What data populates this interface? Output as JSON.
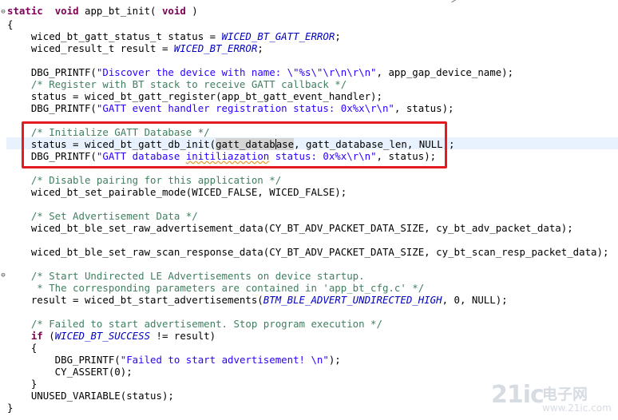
{
  "editor": {
    "fold_markers": {
      "func": "⊖",
      "comment": "⊖"
    },
    "lines": [
      {
        "id": "l01",
        "segs": [
          [
            "kw",
            "static"
          ],
          [
            "",
            ""
          ],
          [
            "",
            "  "
          ],
          [
            "kw",
            "void"
          ],
          [
            "",
            " app_bt_init( "
          ],
          [
            "kw",
            "void"
          ],
          [
            "",
            " )"
          ]
        ]
      },
      {
        "id": "l02",
        "segs": [
          [
            "",
            "{"
          ]
        ]
      },
      {
        "id": "l03",
        "segs": [
          [
            "",
            "    wiced_bt_gatt_status_t status = "
          ],
          [
            "mac",
            "WICED_BT_GATT_ERROR"
          ],
          [
            "",
            ";"
          ]
        ]
      },
      {
        "id": "l04",
        "segs": [
          [
            "",
            "    wiced_result_t result = "
          ],
          [
            "mac",
            "WICED_BT_ERROR"
          ],
          [
            "",
            ";"
          ]
        ]
      },
      {
        "id": "l05",
        "segs": [
          [
            "",
            ""
          ]
        ]
      },
      {
        "id": "l06",
        "segs": [
          [
            "",
            "    DBG_PRINTF("
          ],
          [
            "str",
            "\"Discover the device with name: \\\"%s\\\"\\r\\n\\r\\n\""
          ],
          [
            "",
            ", app_gap_device_name);"
          ]
        ]
      },
      {
        "id": "l07",
        "segs": [
          [
            "cmt",
            "    /* Register with BT stack to receive GATT callback */"
          ]
        ]
      },
      {
        "id": "l08",
        "segs": [
          [
            "",
            "    status = wiced_bt_gatt_register(app_bt_gatt_event_handler);"
          ]
        ]
      },
      {
        "id": "l09",
        "segs": [
          [
            "",
            "    DBG_PRINTF("
          ],
          [
            "str",
            "\"GATT event handler registration status: 0x%x\\r\\n\""
          ],
          [
            "",
            ", status);"
          ]
        ]
      },
      {
        "id": "l10",
        "segs": [
          [
            "",
            ""
          ]
        ]
      },
      {
        "id": "l11",
        "segs": [
          [
            "cmt",
            "    /* Initialize GATT Database */"
          ]
        ]
      },
      {
        "id": "l12",
        "segs": [
          [
            "",
            "    status = wiced_bt_gatt_db_init("
          ],
          [
            "word-hl",
            "gatt_datab"
          ],
          [
            "caret",
            ""
          ],
          [
            "word-hl",
            "ase"
          ],
          [
            "",
            ", gatt_database_len, NULL);"
          ]
        ]
      },
      {
        "id": "l13",
        "segs": [
          [
            "",
            "    DBG_PRINTF("
          ],
          [
            "str",
            "\"GATT database "
          ],
          [
            "str sq",
            "initiliazation"
          ],
          [
            "str",
            " status: 0x%x\\r\\n\""
          ],
          [
            "",
            ", status);"
          ]
        ]
      },
      {
        "id": "l14",
        "segs": [
          [
            "",
            ""
          ]
        ]
      },
      {
        "id": "l15",
        "segs": [
          [
            "cmt",
            "    /* Disable pairing for this application */"
          ]
        ]
      },
      {
        "id": "l16",
        "segs": [
          [
            "",
            "    wiced_bt_set_pairable_mode(WICED_FALSE, WICED_FALSE);"
          ]
        ]
      },
      {
        "id": "l17",
        "segs": [
          [
            "",
            ""
          ]
        ]
      },
      {
        "id": "l18",
        "segs": [
          [
            "cmt",
            "    /* Set Advertisement Data */"
          ]
        ]
      },
      {
        "id": "l19",
        "segs": [
          [
            "",
            "    wiced_bt_ble_set_raw_advertisement_data(CY_BT_ADV_PACKET_DATA_SIZE, cy_bt_adv_packet_data);"
          ]
        ]
      },
      {
        "id": "l20",
        "segs": [
          [
            "",
            ""
          ]
        ]
      },
      {
        "id": "l21",
        "segs": [
          [
            "",
            "    wiced_bt_ble_set_raw_scan_response_data(CY_BT_ADV_PACKET_DATA_SIZE, cy_bt_scan_resp_packet_data);"
          ]
        ]
      },
      {
        "id": "l22",
        "segs": [
          [
            "",
            ""
          ]
        ]
      },
      {
        "id": "l23",
        "segs": [
          [
            "cmt",
            "    /* Start Undirected LE Advertisements on device startup."
          ]
        ]
      },
      {
        "id": "l24",
        "segs": [
          [
            "cmt",
            "     * The corresponding parameters are contained in 'app_bt_cfg.c' */"
          ]
        ]
      },
      {
        "id": "l25",
        "segs": [
          [
            "",
            "    result = wiced_bt_start_advertisements("
          ],
          [
            "mac",
            "BTM_BLE_ADVERT_UNDIRECTED_HIGH"
          ],
          [
            "",
            ", 0, NULL);"
          ]
        ]
      },
      {
        "id": "l26",
        "segs": [
          [
            "",
            ""
          ]
        ]
      },
      {
        "id": "l27",
        "segs": [
          [
            "cmt",
            "    /* Failed to start advertisement. Stop program execution */"
          ]
        ]
      },
      {
        "id": "l28",
        "segs": [
          [
            "kw",
            "    if"
          ],
          [
            "",
            " ("
          ],
          [
            "mac",
            "WICED_BT_SUCCESS"
          ],
          [
            "",
            " != result)"
          ]
        ]
      },
      {
        "id": "l29",
        "segs": [
          [
            "",
            "    {"
          ]
        ]
      },
      {
        "id": "l30",
        "segs": [
          [
            "",
            "        DBG_PRINTF("
          ],
          [
            "str",
            "\"Failed to start advertisement! \\n\""
          ],
          [
            "",
            ");"
          ]
        ]
      },
      {
        "id": "l31",
        "segs": [
          [
            "",
            "        CY_ASSERT(0);"
          ]
        ]
      },
      {
        "id": "l32",
        "segs": [
          [
            "",
            "    }"
          ]
        ]
      },
      {
        "id": "l33",
        "segs": [
          [
            "",
            "    UNUSED_VARIABLE(status);"
          ]
        ]
      },
      {
        "id": "l34",
        "segs": [
          [
            "",
            "}"
          ]
        ]
      }
    ]
  },
  "watermark": {
    "main": "21ic",
    "sub": "电子网",
    "url": "www.21ic.com"
  }
}
